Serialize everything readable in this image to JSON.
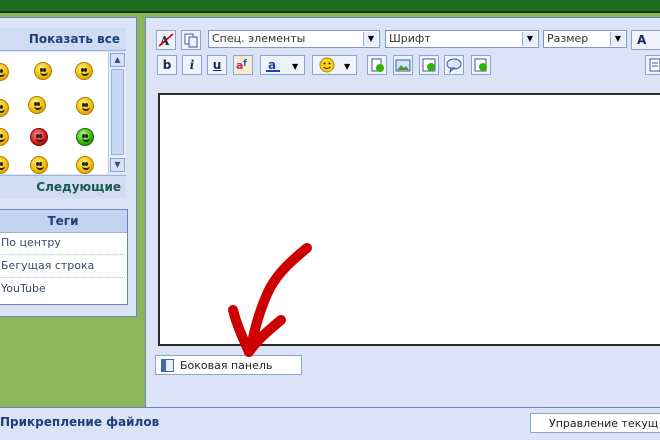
{
  "smilies": {
    "show_all": "Показать все",
    "next": "Следующие"
  },
  "tags": {
    "title": "Теги",
    "items": [
      "По центру",
      "Бегущая строка",
      "YouTube"
    ]
  },
  "toolbar": {
    "special_elements": "Спец. элементы",
    "font": "Шрифт",
    "size": "Размер",
    "bold": "b",
    "italic": "i",
    "underline": "u",
    "font_letter": "A"
  },
  "editor": {
    "side_panel": "Боковая панель"
  },
  "footer": {
    "attach_files": "Прикрепление файлов",
    "manage_current": "Управление текущ"
  },
  "colors": {
    "frame": "#8bb65a",
    "panel": "#dbe4f6",
    "annotation": "#cc0000"
  }
}
